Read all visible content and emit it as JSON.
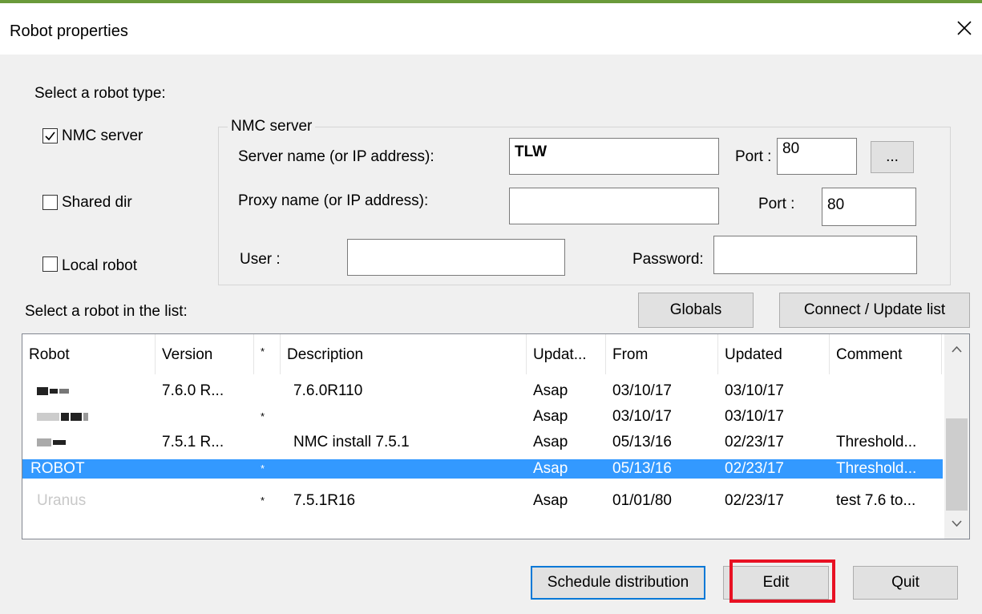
{
  "window": {
    "title": "Robot properties",
    "accent_color": "#6a9a3a"
  },
  "robot_type": {
    "heading": "Select a robot type:",
    "options": [
      {
        "label": "NMC server",
        "checked": true
      },
      {
        "label": "Shared dir",
        "checked": false
      },
      {
        "label": "Local robot",
        "checked": false
      }
    ]
  },
  "nmc_group": {
    "legend": "NMC server",
    "server_label": "Server name (or IP address):",
    "server_value": "TLW",
    "server_port_label": "Port :",
    "server_port_value": "80",
    "browse_label": "...",
    "proxy_label": "Proxy name (or IP address):",
    "proxy_value": "",
    "proxy_port_label": "Port :",
    "proxy_port_value": "80",
    "user_label": "User :",
    "user_value": "",
    "password_label": "Password:",
    "password_value": ""
  },
  "robot_list": {
    "heading": "Select a robot in the list:",
    "globals_label": "Globals",
    "connect_label": "Connect / Update list",
    "columns": [
      "Robot",
      "Version",
      "*",
      "Description",
      "Updat...",
      "From",
      "Updated",
      "Comment"
    ],
    "rows": [
      {
        "robot": "",
        "version": "7.6.0 R...",
        "star": "",
        "description": "7.6.0R110",
        "update": "Asap",
        "from": "03/10/17",
        "updated": "03/10/17",
        "comment": "",
        "selected": false
      },
      {
        "robot": "",
        "version": "",
        "star": "*",
        "description": "",
        "update": "Asap",
        "from": "03/10/17",
        "updated": "03/10/17",
        "comment": "",
        "selected": false
      },
      {
        "robot": "",
        "version": "7.5.1 R...",
        "star": "",
        "description": "NMC install 7.5.1",
        "update": "Asap",
        "from": "05/13/16",
        "updated": "02/23/17",
        "comment": "Threshold...",
        "selected": false
      },
      {
        "robot": "ROBOT",
        "version": "",
        "star": "*",
        "description": "",
        "update": "Asap",
        "from": "05/13/16",
        "updated": "02/23/17",
        "comment": "Threshold...",
        "selected": true
      },
      {
        "robot": "Uranus",
        "version": "",
        "star": "*",
        "description": "7.5.1R16",
        "update": "Asap",
        "from": "01/01/80",
        "updated": "02/23/17",
        "comment": "test 7.6 to...",
        "selected": false
      }
    ],
    "selection_color": "#3399ff"
  },
  "footer": {
    "schedule_label": "Schedule distribution",
    "edit_label": "Edit",
    "quit_label": "Quit",
    "highlight_color": "#e81123"
  }
}
